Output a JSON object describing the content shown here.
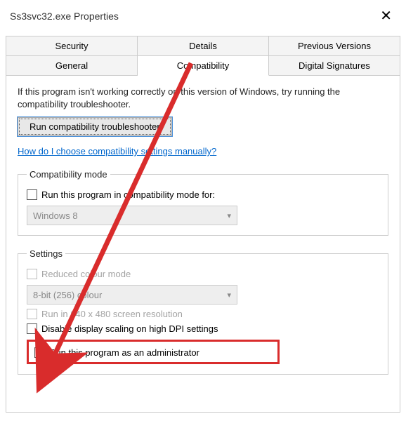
{
  "window": {
    "title": "Ss3svc32.exe Properties"
  },
  "tabs": {
    "row1": {
      "security": "Security",
      "details": "Details",
      "previous": "Previous Versions"
    },
    "row2": {
      "general": "General",
      "compat": "Compatibility",
      "digsig": "Digital Signatures"
    }
  },
  "panel": {
    "intro": "If this program isn't working correctly on this version of Windows, try running the compatibility troubleshooter.",
    "run_troubleshooter_btn": "Run compatibility troubleshooter",
    "manual_link": "How do I choose compatibility settings manually?"
  },
  "compat_mode": {
    "legend": "Compatibility mode",
    "check_label": "Run this program in compatibility mode for:",
    "select_value": "Windows 8"
  },
  "settings": {
    "legend": "Settings",
    "reduced_colour": "Reduced colour mode",
    "colour_select": "8-bit (256) colour",
    "low_res": "Run in 640 x 480 screen resolution",
    "disable_dpi": "Disable display scaling on high DPI settings",
    "run_admin": "Run this program as an administrator"
  }
}
